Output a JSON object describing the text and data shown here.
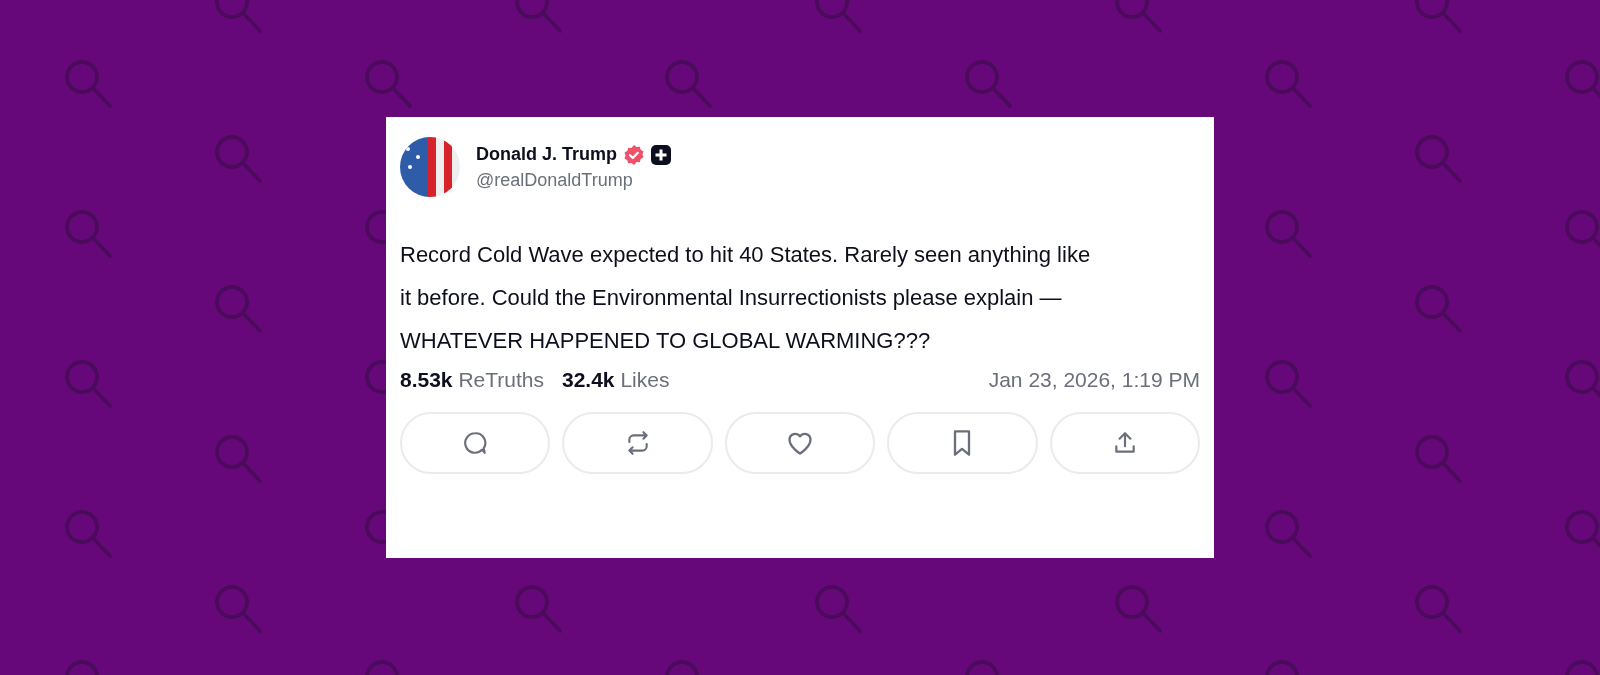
{
  "post": {
    "author": {
      "name": "Donald J. Trump",
      "handle": "@realDonaldTrump"
    },
    "text": "Record Cold Wave expected to hit 40 States. Rarely seen anything like it before. Could the Environmental Insurrectionists please explain — WHATEVER HAPPENED TO GLOBAL WARMING???",
    "stats": [
      {
        "count": "8.53k",
        "label": "ReTruths"
      },
      {
        "count": "32.4k",
        "label": "Likes"
      }
    ],
    "timestamp": "Jan 23, 2026, 1:19 PM",
    "actions": [
      {
        "kind": "reply"
      },
      {
        "kind": "repost"
      },
      {
        "kind": "like"
      },
      {
        "kind": "bookmark"
      },
      {
        "kind": "share"
      }
    ]
  }
}
